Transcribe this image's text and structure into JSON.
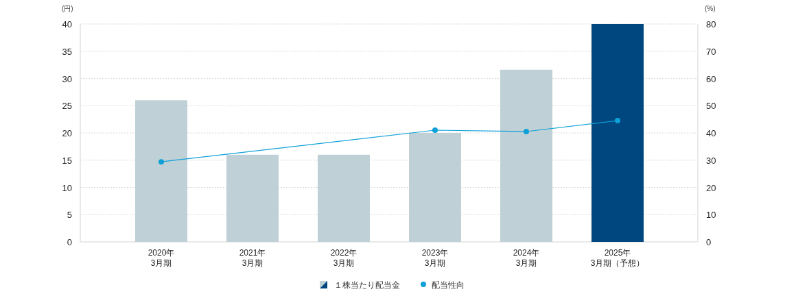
{
  "chart_data": {
    "type": "bar",
    "ylabel": "(円)",
    "y2label": "(%)",
    "grid": true,
    "legend": "bottom",
    "categories": [
      "2020年\n3月期",
      "2021年\n3月期",
      "2022年\n3月期",
      "2023年\n3月期",
      "2024年\n3月期",
      "2025年\n3月期（予想）"
    ],
    "ylim": [
      0,
      40
    ],
    "yticks": [
      0,
      5,
      10,
      15,
      20,
      25,
      30,
      35,
      40
    ],
    "y2lim": [
      0,
      80
    ],
    "y2ticks": [
      0,
      10,
      20,
      30,
      40,
      50,
      60,
      70,
      80
    ],
    "series": [
      {
        "name": "１株当たり配当金",
        "color": "#bfd0d6",
        "colors": [
          "#bfd0d6",
          "#bfd0d6",
          "#bfd0d6",
          "#bfd0d6",
          "#bfd0d6",
          "#00467f"
        ],
        "values": [
          26,
          16,
          16,
          20,
          31.6,
          40
        ]
      },
      {
        "name": "配当性向",
        "type": "line",
        "axis": "y2",
        "marker": "circle",
        "color": "#0ea0d8",
        "values": [
          29.4,
          null,
          null,
          41.0,
          40.5,
          44.5
        ]
      }
    ]
  }
}
